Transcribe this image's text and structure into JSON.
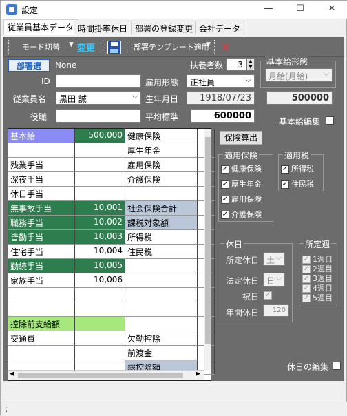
{
  "window": {
    "title": "設定"
  },
  "tabs": [
    "従業員基本データ",
    "時間掛率休日",
    "部署の登録変更",
    "会社データ"
  ],
  "toolbar": {
    "mode": "モード切替",
    "change": "変更",
    "dept_tpl": "部署テンプレート適用"
  },
  "form": {
    "dept_btn": "部署選",
    "dept_val": "None",
    "dependents_label": "扶養者数",
    "dependents_val": "3",
    "id_label": "ID",
    "id_val": "",
    "emp_type_label": "雇用形態",
    "emp_type_val": "正社員",
    "name_label": "従業員名",
    "name_val": "黒田 誠",
    "birth_label": "生年月日",
    "birth_val": "1918/07/23",
    "post_label": "役職",
    "post_val": "",
    "avg_label": "平均標準",
    "avg_val": "600000",
    "salary_type_label": "基本給形態",
    "salary_type_val": "月給(月給)",
    "salary_val": "500000",
    "salary_edit_label": "基本給編集"
  },
  "grid": [
    [
      "基本給",
      "500,000",
      "健康保険",
      ""
    ],
    [
      "",
      "",
      "厚生年金",
      ""
    ],
    [
      "残業手当",
      "",
      "雇用保険",
      ""
    ],
    [
      "深夜手当",
      "",
      "介護保険",
      ""
    ],
    [
      "休日手当",
      "",
      "",
      ""
    ],
    [
      "無事故手当",
      "10,001",
      "社会保険合計",
      ""
    ],
    [
      "職務手当",
      "10,002",
      "課税対象額",
      ""
    ],
    [
      "皆勤手当",
      "10,003",
      "所得税",
      ""
    ],
    [
      "住宅手当",
      "10,004",
      "住民税",
      ""
    ],
    [
      "勤続手当",
      "10,005",
      "",
      ""
    ],
    [
      "家族手当",
      "10,006",
      "",
      ""
    ],
    [
      "",
      "",
      "",
      ""
    ],
    [
      "",
      "",
      "",
      ""
    ],
    [
      "控除前支給額",
      "",
      "",
      ""
    ],
    [
      "交通費",
      "",
      "欠勤控除",
      ""
    ],
    [
      "",
      "",
      "前渡金",
      ""
    ],
    [
      "",
      "",
      "総控除額",
      ""
    ]
  ],
  "insurance": {
    "calc_btn": "保険算出",
    "title": "適用保険",
    "items": [
      "健康保険",
      "厚生年金",
      "雇用保険",
      "介護保険"
    ]
  },
  "tax": {
    "title": "適用税",
    "items": [
      "所得税",
      "住民税"
    ]
  },
  "holiday": {
    "title": "休日",
    "regular_label": "所定休日",
    "regular_val": "土",
    "legal_label": "法定休日",
    "legal_val": "日",
    "holiday_label": "祝日",
    "annual_label": "年間休日",
    "annual_val": "120"
  },
  "weeks": {
    "title": "所定週",
    "items": [
      "1週目",
      "2週目",
      "3週目",
      "4週目",
      "5週目"
    ]
  },
  "holiday_edit": "休日の編集",
  "status": ":"
}
